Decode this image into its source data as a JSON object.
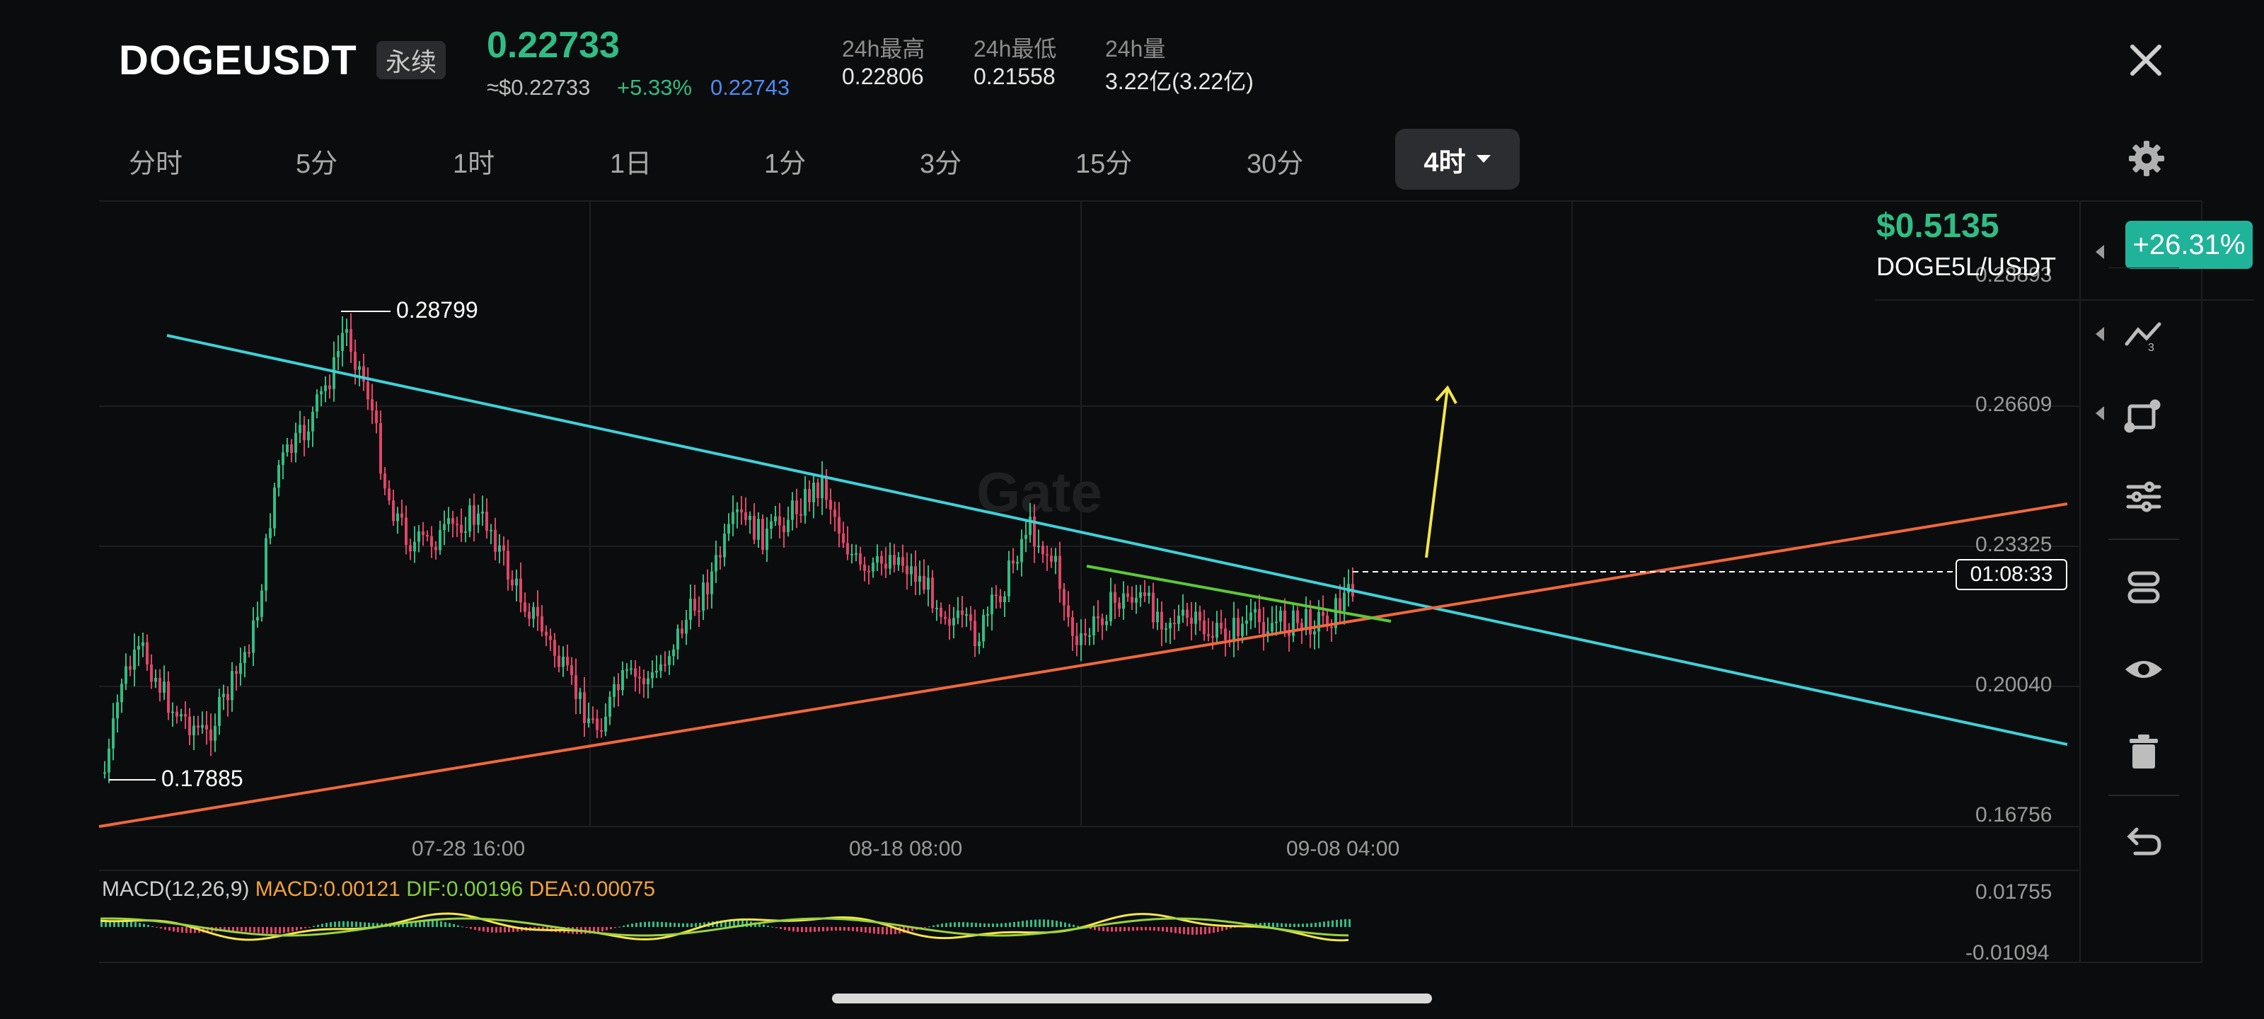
{
  "header": {
    "symbol": "DOGEUSDT",
    "contract_type": "永续",
    "last_price": "0.22733",
    "usd_price": "≈$0.22733",
    "change_pct": "+5.33%",
    "mark_price": "0.22743",
    "stats": [
      {
        "label": "24h最高",
        "value": "0.22806"
      },
      {
        "label": "24h最低",
        "value": "0.21558"
      },
      {
        "label": "24h量",
        "value": "3.22亿(3.22亿)"
      }
    ]
  },
  "intervals": [
    "分时",
    "5分",
    "1时",
    "1日",
    "1分",
    "3分",
    "15分",
    "30分"
  ],
  "active_interval": "4时",
  "chart": {
    "watermark": "Gate",
    "price_axis": [
      "0.28893",
      "0.26609",
      "0.23325",
      "0.20040",
      "0.16756"
    ],
    "time_axis": [
      "07-28 16:00",
      "08-18 08:00",
      "09-08 04:00"
    ],
    "high_marker": "0.28799",
    "low_marker": "0.17885",
    "countdown": "01:08:33",
    "macd": {
      "title": "MACD(12,26,9)",
      "macd": "MACD:0.00121",
      "dif": "DIF:0.00196",
      "dea": "DEA:0.00075",
      "axis": [
        "0.01755",
        "-0.01094"
      ]
    }
  },
  "promo": {
    "price": "$0.5135",
    "pair": "DOGE5L/USDT",
    "change": "+26.31%"
  },
  "tools": [
    "indicator-icon",
    "drawing-icon",
    "adjust-icon",
    "layers-icon",
    "eye-icon",
    "trash-icon",
    "undo-icon"
  ],
  "colors": {
    "up": "#2fbd85",
    "down": "#e0446a",
    "accent_blue": "#4c8bf5",
    "trend_cyan": "#3ed1d8",
    "trend_orange": "#f0683c",
    "trend_green": "#5cc83b",
    "arrow_yellow": "#f4e64a"
  }
}
